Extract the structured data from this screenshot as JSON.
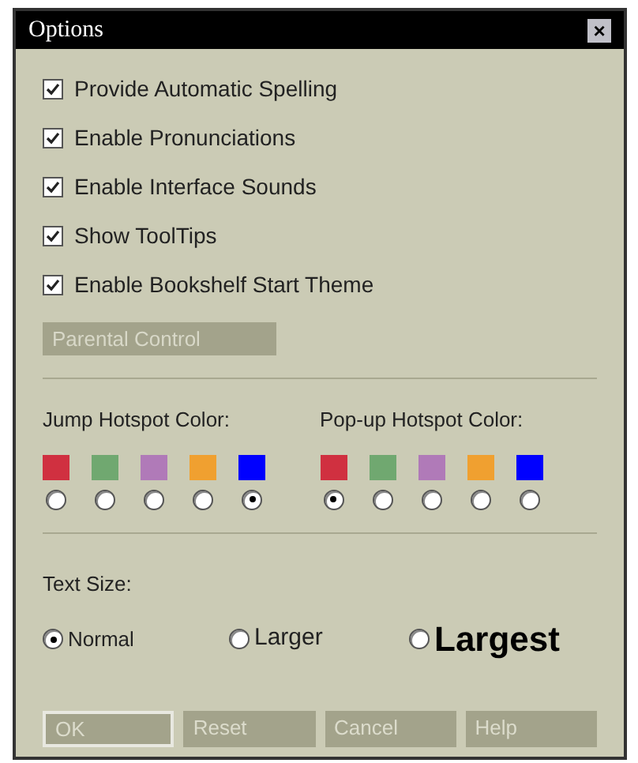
{
  "window": {
    "title": "Options",
    "close": "×"
  },
  "checkboxes": [
    {
      "label": "Provide Automatic Spelling",
      "checked": true
    },
    {
      "label": "Enable Pronunciations",
      "checked": true
    },
    {
      "label": "Enable Interface Sounds",
      "checked": true
    },
    {
      "label": "Show ToolTips",
      "checked": true
    },
    {
      "label": "Enable Bookshelf Start Theme",
      "checked": true
    }
  ],
  "parental_control": {
    "label": "Parental Control",
    "disabled": true
  },
  "hotspot_groups": [
    {
      "label": "Jump Hotspot Color:",
      "colors": [
        {
          "color": "#d03040",
          "selected": false
        },
        {
          "color": "#70a870",
          "selected": false
        },
        {
          "color": "#b07ab8",
          "selected": false
        },
        {
          "color": "#f0a030",
          "selected": false
        },
        {
          "color": "#0000ff",
          "selected": true
        }
      ]
    },
    {
      "label": "Pop-up Hotspot Color:",
      "colors": [
        {
          "color": "#d03040",
          "selected": true
        },
        {
          "color": "#70a870",
          "selected": false
        },
        {
          "color": "#b07ab8",
          "selected": false
        },
        {
          "color": "#f0a030",
          "selected": false
        },
        {
          "color": "#0000ff",
          "selected": false
        }
      ]
    }
  ],
  "text_size": {
    "label": "Text Size:",
    "options": [
      {
        "label": "Normal",
        "kind": "normal",
        "selected": true
      },
      {
        "label": "Larger",
        "kind": "larger",
        "selected": false
      },
      {
        "label": "Largest",
        "kind": "largest",
        "selected": false
      }
    ]
  },
  "buttons": [
    {
      "label": "OK",
      "default": true
    },
    {
      "label": "Reset",
      "default": false
    },
    {
      "label": "Cancel",
      "default": false
    },
    {
      "label": "Help",
      "default": false
    }
  ]
}
